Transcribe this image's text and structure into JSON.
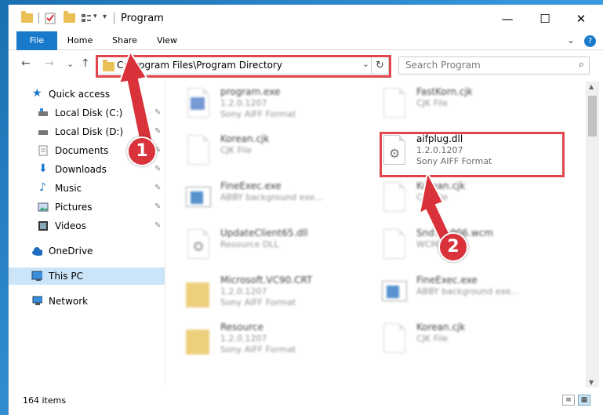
{
  "window": {
    "title": "Program"
  },
  "title_controls": {
    "minimize": "—",
    "maximize": "☐",
    "close": "✕"
  },
  "ribbon": {
    "tabs": [
      "File",
      "Home",
      "Share",
      "View"
    ],
    "expand_glyph": "⌄",
    "help_glyph": "?"
  },
  "nav": {
    "back": "←",
    "forward": "→",
    "recent": "⌄",
    "up": "↑",
    "address": "C:\\Program Files\\Program Directory",
    "address_dropdown": "⌄",
    "refresh": "↻",
    "search_placeholder": "Search Program",
    "search_glyph": "⌕"
  },
  "sidebar": {
    "items": [
      {
        "label": "Quick access",
        "icon": "star-icon",
        "pinned": false
      },
      {
        "label": "Local Disk (C:)",
        "icon": "drive-icon",
        "pinned": true
      },
      {
        "label": "Local Disk (D:)",
        "icon": "drive-icon",
        "pinned": true
      },
      {
        "label": "Documents",
        "icon": "documents-icon",
        "pinned": true
      },
      {
        "label": "Downloads",
        "icon": "downloads-icon",
        "pinned": true
      },
      {
        "label": "Music",
        "icon": "music-icon",
        "pinned": true
      },
      {
        "label": "Pictures",
        "icon": "pictures-icon",
        "pinned": true
      },
      {
        "label": "Videos",
        "icon": "videos-icon",
        "pinned": true
      },
      {
        "label": "OneDrive",
        "icon": "onedrive-icon",
        "pinned": false
      },
      {
        "label": "This PC",
        "icon": "pc-icon",
        "pinned": false,
        "selected": true
      },
      {
        "label": "Network",
        "icon": "network-icon",
        "pinned": false
      }
    ],
    "pin_glyph": "📌"
  },
  "files": {
    "left": [
      {
        "name": "program.exe",
        "line1": "1.2.0.1207",
        "line2": "Sony AIFF Format",
        "icon": "exe-icon"
      },
      {
        "name": "Korean.cjk",
        "line1": "CJK File",
        "line2": "",
        "icon": "file-icon"
      },
      {
        "name": "FineExec.exe",
        "line1": "ABBY background exe...",
        "line2": "",
        "icon": "app-window-icon"
      },
      {
        "name": "UpdateClient65.dll",
        "line1": "Resource DLL",
        "line2": "",
        "icon": "dll-icon"
      },
      {
        "name": "Microsoft.VC90.CRT",
        "line1": "1.2.0.1207",
        "line2": "Sony AIFF Format",
        "icon": "folder-icon"
      },
      {
        "name": "Resource",
        "line1": "1.2.0.1207",
        "line2": "Sony AIFF Format",
        "icon": "folder-icon"
      }
    ],
    "right": [
      {
        "name": "FastKorn.cjk",
        "line1": "CJK File",
        "line2": "",
        "icon": "file-icon"
      },
      {
        "name": "aifplug.dll",
        "line1": "1.2.0.1207",
        "line2": "Sony AIFF Format",
        "icon": "dll-gear-icon"
      },
      {
        "name": "Korean.cjk",
        "line1": "CJK File",
        "line2": "",
        "icon": "file-icon"
      },
      {
        "name": "SndTo1906.wcm",
        "line1": "WCM File",
        "line2": "",
        "icon": "file-icon"
      },
      {
        "name": "FineExec.exe",
        "line1": "ABBY background exe...",
        "line2": "",
        "icon": "app-window-icon"
      },
      {
        "name": "Korean.cjk",
        "line1": "CJK File",
        "line2": "",
        "icon": "file-icon"
      }
    ]
  },
  "status": {
    "item_count": "164 items"
  },
  "callouts": [
    "1",
    "2"
  ],
  "colors": {
    "accent": "#1979ca",
    "highlight": "#e0464b",
    "callout": "#d9323a",
    "selection": "#cce4f7"
  }
}
